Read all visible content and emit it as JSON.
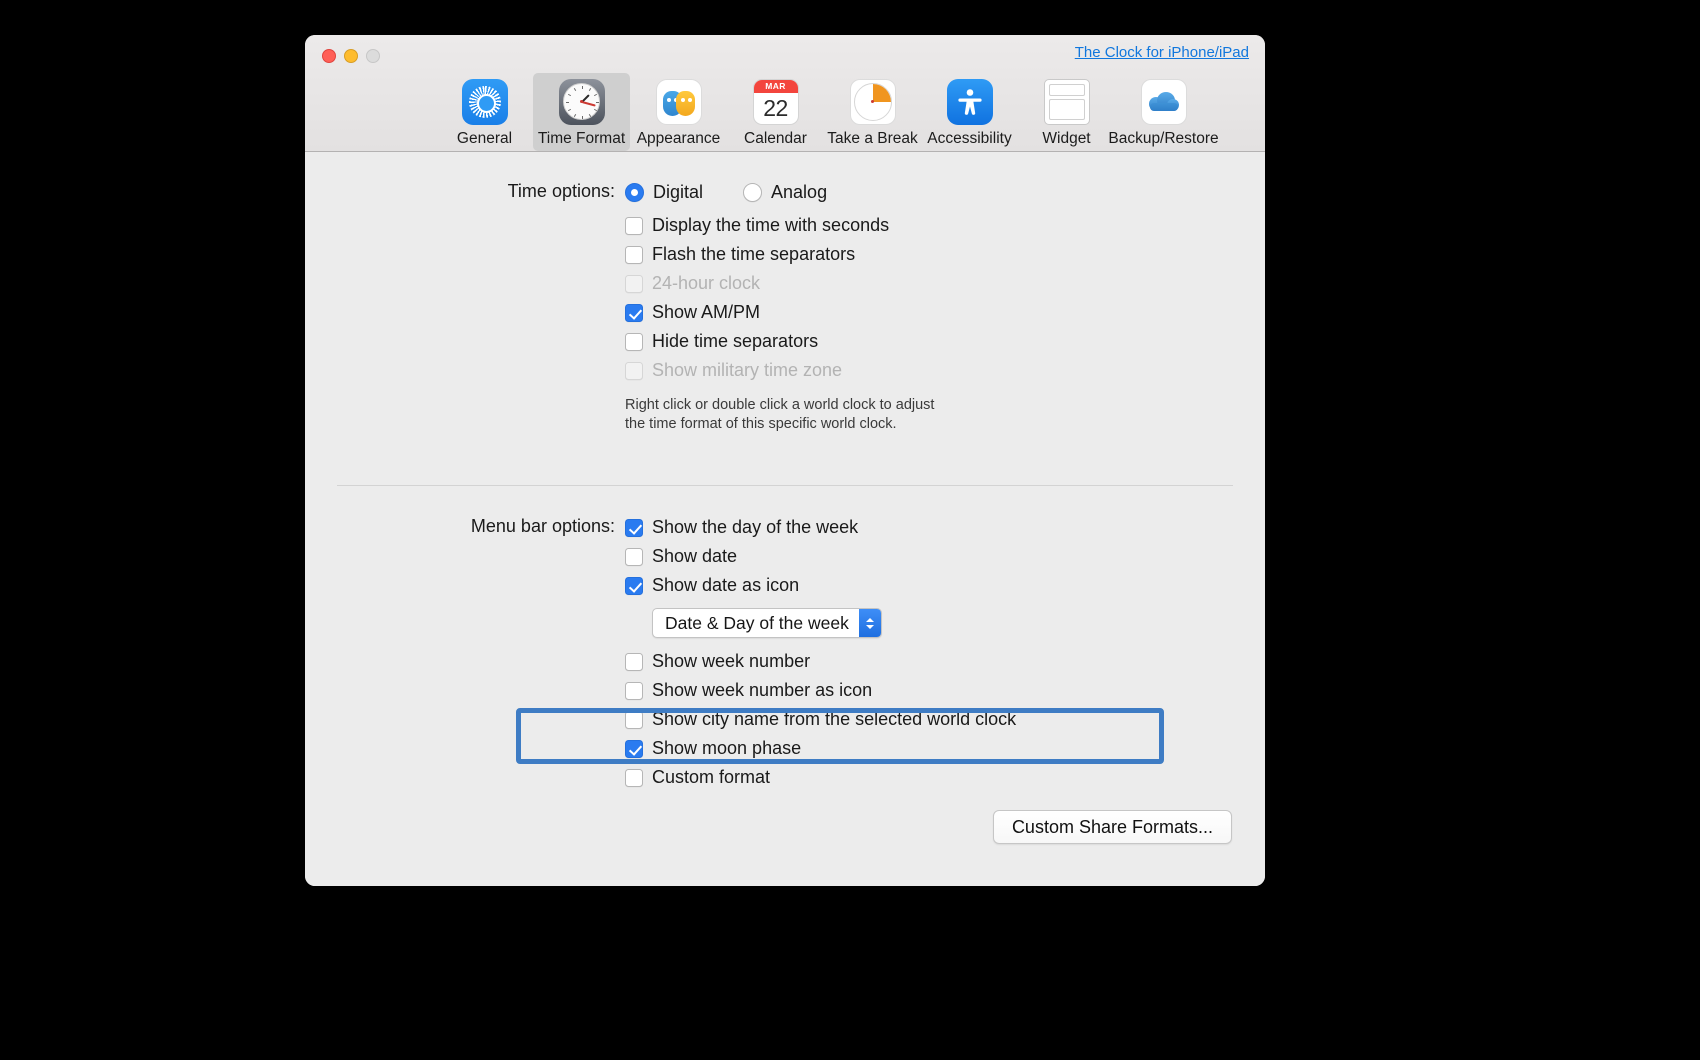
{
  "window": {
    "top_link": "The Clock for iPhone/iPad",
    "traffic_lights": [
      "close-button",
      "minimize-button",
      "zoom-button"
    ]
  },
  "toolbar": {
    "items": [
      {
        "label": "General",
        "icon": "gear-icon",
        "selected": false
      },
      {
        "label": "Time Format",
        "icon": "clock-icon",
        "selected": true
      },
      {
        "label": "Appearance",
        "icon": "theater-masks-icon",
        "selected": false
      },
      {
        "label": "Calendar",
        "icon": "calendar-icon",
        "selected": false,
        "badge_month": "MAR",
        "badge_day": "22"
      },
      {
        "label": "Take a Break",
        "icon": "timer-icon",
        "selected": false
      },
      {
        "label": "Accessibility",
        "icon": "accessibility-icon",
        "selected": false
      },
      {
        "label": "Widget",
        "icon": "widget-icon",
        "selected": false
      },
      {
        "label": "Backup/Restore",
        "icon": "cloud-icon",
        "selected": false
      }
    ]
  },
  "time_options": {
    "label": "Time options:",
    "radios": [
      {
        "label": "Digital",
        "checked": true
      },
      {
        "label": "Analog",
        "checked": false
      }
    ],
    "checkboxes": [
      {
        "label": "Display the time with seconds",
        "checked": false,
        "disabled": false
      },
      {
        "label": "Flash the time separators",
        "checked": false,
        "disabled": false
      },
      {
        "label": "24-hour clock",
        "checked": false,
        "disabled": true
      },
      {
        "label": "Show AM/PM",
        "checked": true,
        "disabled": false
      },
      {
        "label": "Hide time separators",
        "checked": false,
        "disabled": false
      },
      {
        "label": "Show military time zone",
        "checked": false,
        "disabled": true
      }
    ],
    "hint_line1": "Right click or double click a world clock to adjust",
    "hint_line2": "the time format of this specific world clock."
  },
  "menu_bar_options": {
    "label": "Menu bar options:",
    "group1": [
      {
        "label": "Show the day of the week",
        "checked": true
      },
      {
        "label": "Show date",
        "checked": false
      },
      {
        "label": "Show date as icon",
        "checked": true
      }
    ],
    "popup": {
      "selected": "Date & Day of the week"
    },
    "group2": [
      {
        "label": "Show week number",
        "checked": false,
        "highlighted": false
      },
      {
        "label": "Show week number as icon",
        "checked": false,
        "highlighted": false
      },
      {
        "label": "Show city name from the selected world clock",
        "checked": false,
        "highlighted": false
      },
      {
        "label": "Show moon phase",
        "checked": true,
        "highlighted": true
      },
      {
        "label": "Custom format",
        "checked": false,
        "highlighted": false
      }
    ]
  },
  "footer": {
    "custom_share_formats_button": "Custom Share Formats..."
  },
  "colors": {
    "accent": "#2a7bf0",
    "link": "#1177dd",
    "highlight_box": "#3e7cc4",
    "window_bg": "#ececec",
    "toolbar_bg": "#e6e4e4"
  }
}
